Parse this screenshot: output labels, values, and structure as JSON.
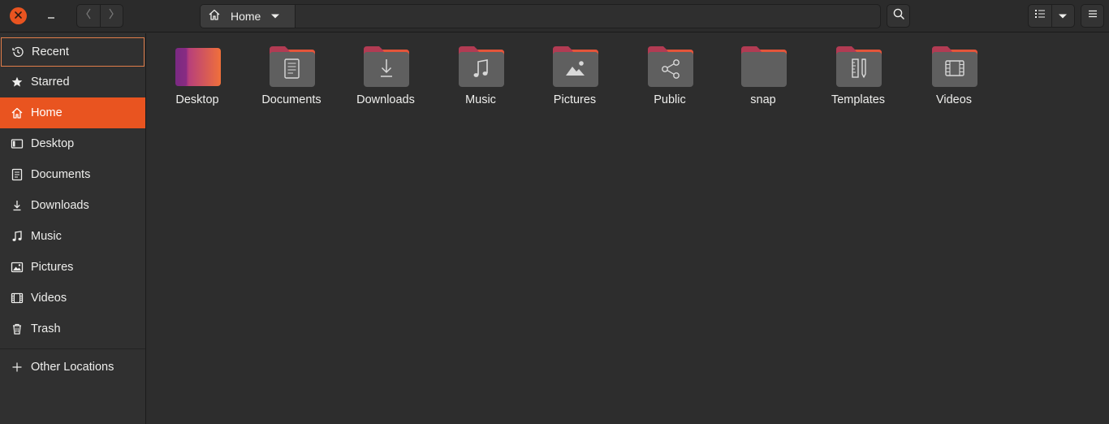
{
  "window": {
    "path_current": "Home"
  },
  "colors": {
    "accent": "#e95420",
    "folder_tab": "#b23b53",
    "folder_body": "#5f5f5f",
    "desktop_gradient_start": "#8b2c86",
    "desktop_gradient_end": "#ee6b3a"
  },
  "icons": {
    "close": "close-icon",
    "minimize": "minimize-icon",
    "back": "chevron-left-icon",
    "forward": "chevron-right-icon",
    "path_home": "home-icon",
    "path_menu": "caret-down-icon",
    "search": "search-icon",
    "list_view": "list-view-icon",
    "view_options": "caret-down-icon",
    "main_menu": "hamburger-menu-icon"
  },
  "sidebar": {
    "items": [
      {
        "label": "Recent",
        "icon": "clock-icon"
      },
      {
        "label": "Starred",
        "icon": "star-icon"
      },
      {
        "label": "Home",
        "icon": "home-icon"
      },
      {
        "label": "Desktop",
        "icon": "desktop-icon"
      },
      {
        "label": "Documents",
        "icon": "document-icon"
      },
      {
        "label": "Downloads",
        "icon": "download-icon"
      },
      {
        "label": "Music",
        "icon": "music-icon"
      },
      {
        "label": "Pictures",
        "icon": "picture-icon"
      },
      {
        "label": "Videos",
        "icon": "video-icon"
      },
      {
        "label": "Trash",
        "icon": "trash-icon"
      }
    ],
    "other_locations": {
      "label": "Other Locations",
      "icon": "plus-icon"
    }
  },
  "files": [
    {
      "name": "Desktop",
      "icon": "desktop-folder-icon"
    },
    {
      "name": "Documents",
      "icon": "documents-folder-icon"
    },
    {
      "name": "Downloads",
      "icon": "downloads-folder-icon"
    },
    {
      "name": "Music",
      "icon": "music-folder-icon"
    },
    {
      "name": "Pictures",
      "icon": "pictures-folder-icon"
    },
    {
      "name": "Public",
      "icon": "public-folder-icon"
    },
    {
      "name": "snap",
      "icon": "folder-icon"
    },
    {
      "name": "Templates",
      "icon": "templates-folder-icon"
    },
    {
      "name": "Videos",
      "icon": "videos-folder-icon"
    }
  ]
}
